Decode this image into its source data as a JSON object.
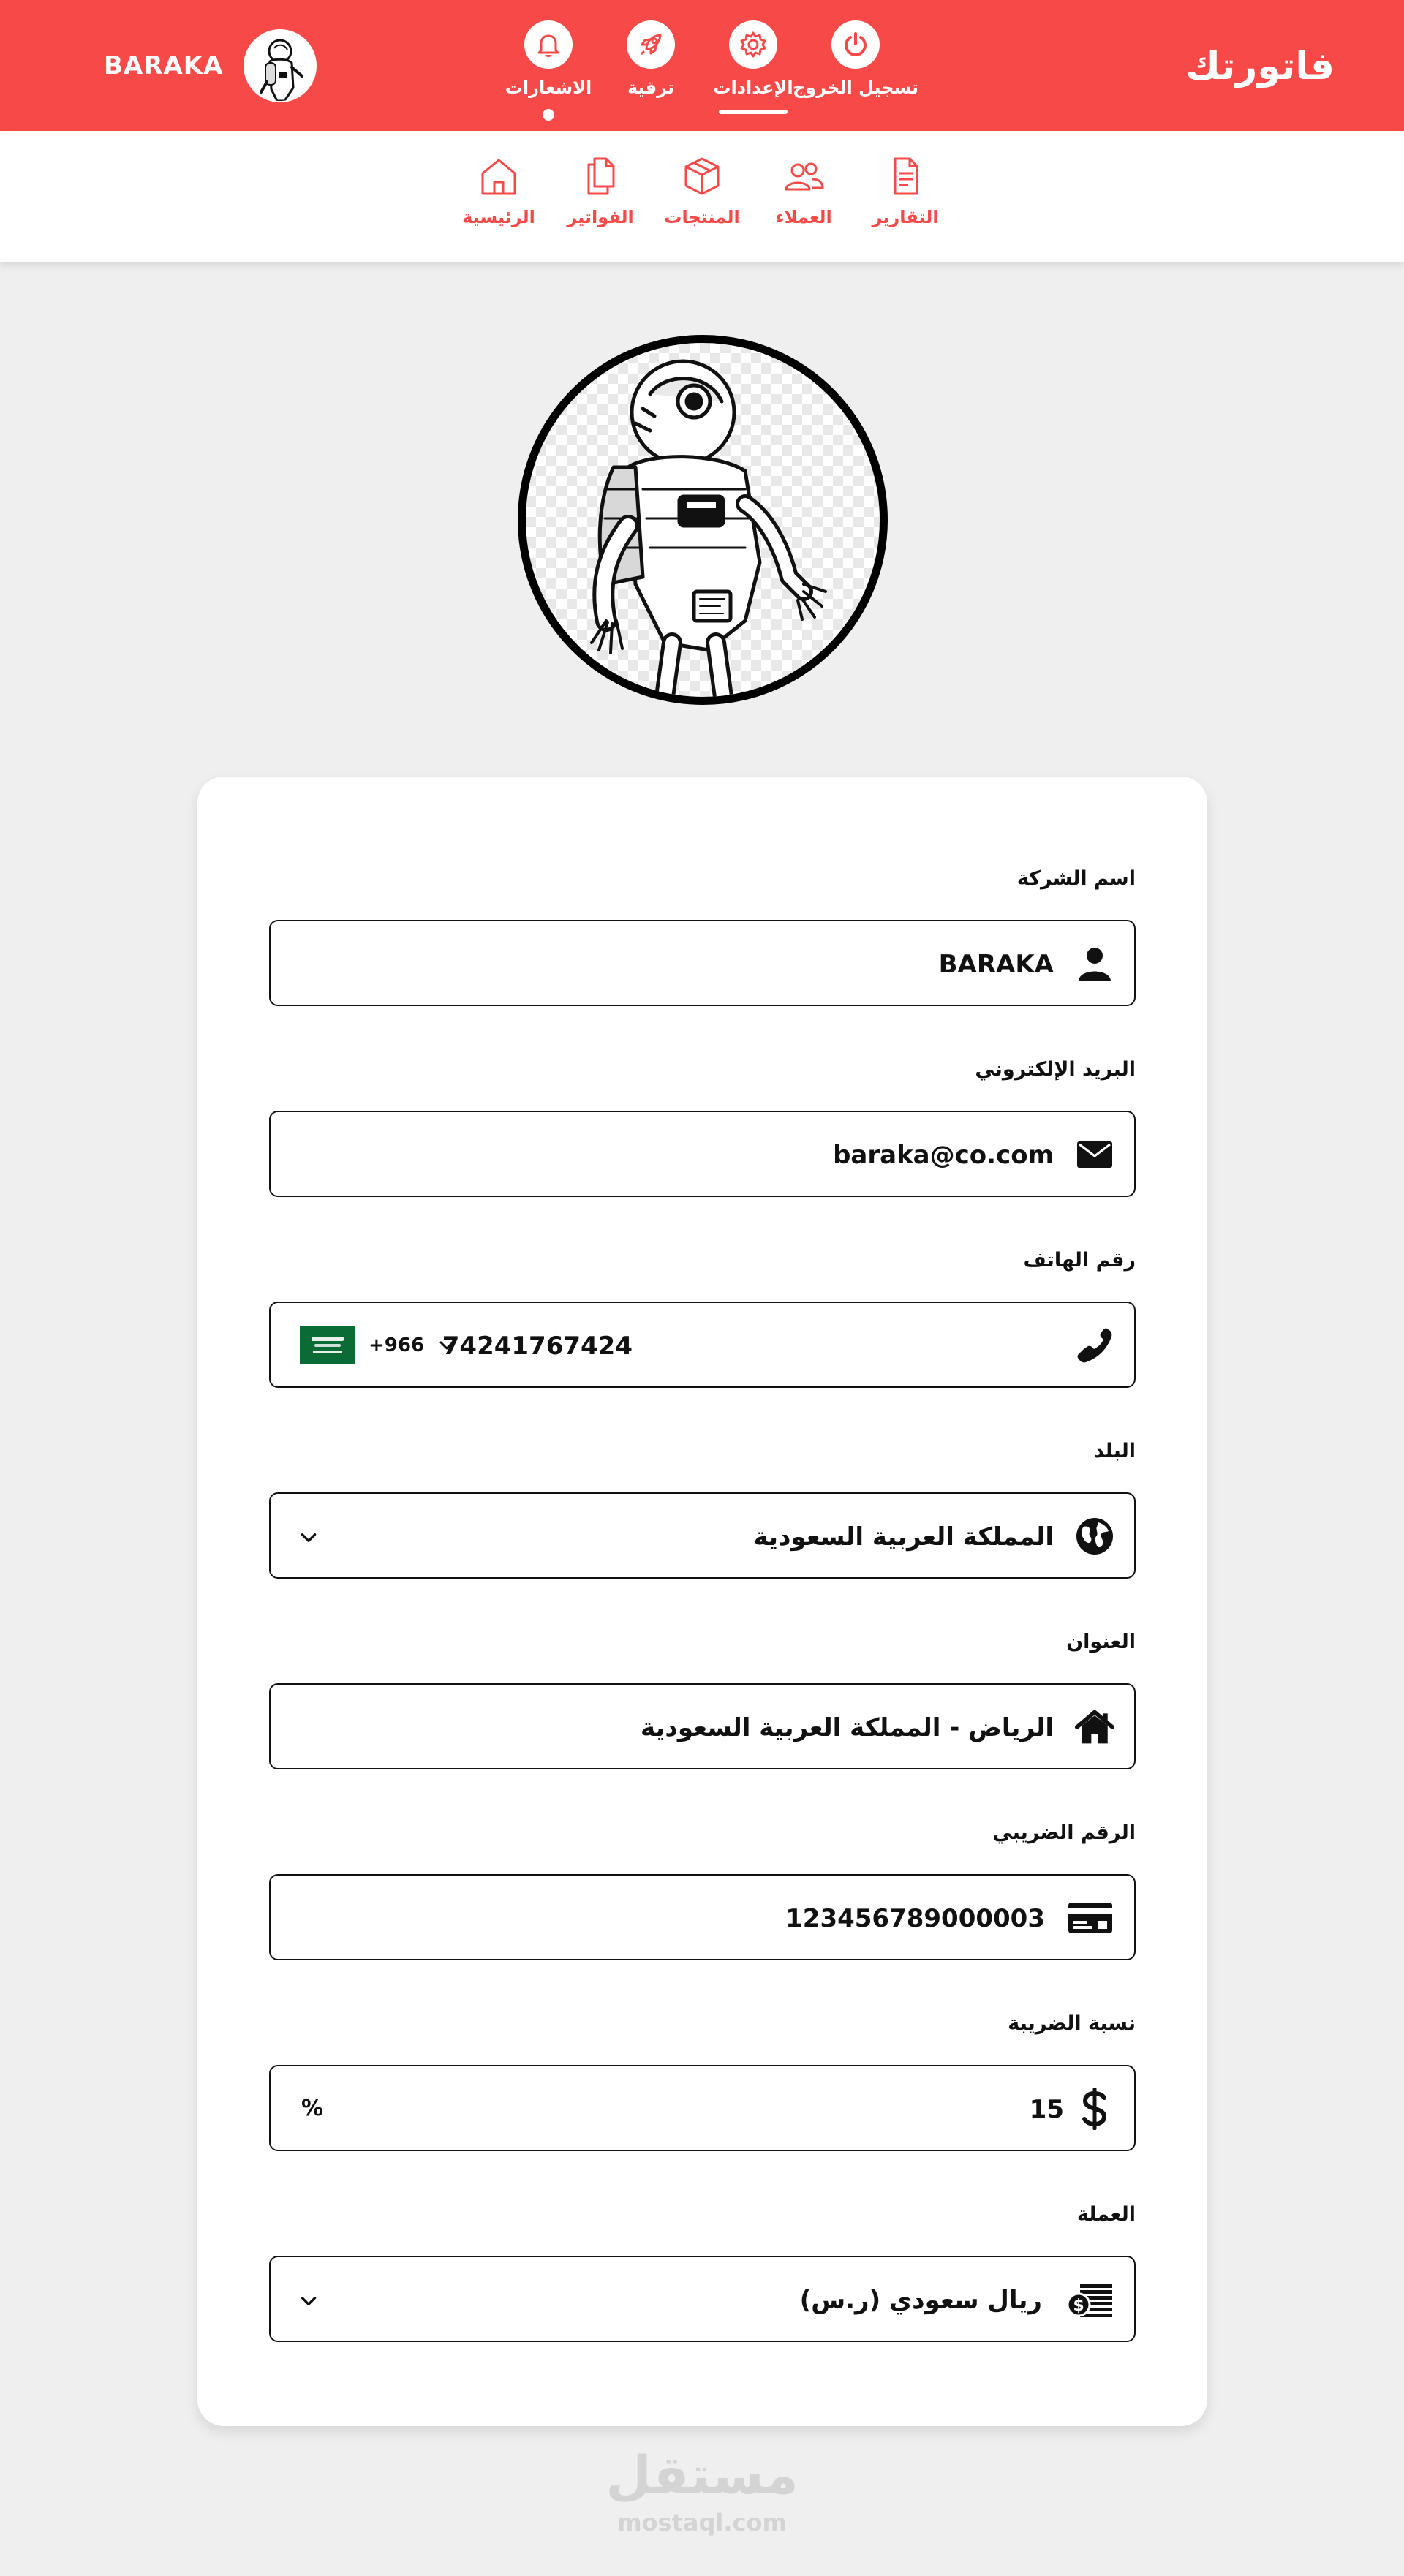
{
  "header": {
    "brand": "فاتورتك",
    "user_name": "BARAKA",
    "actions": [
      {
        "label": "الاشعارات",
        "icon": "bell-icon",
        "indicator": "dot"
      },
      {
        "label": "ترقية",
        "icon": "rocket-icon",
        "indicator": ""
      },
      {
        "label": "الإعدادات",
        "icon": "gear-icon",
        "indicator": "underline",
        "active": true
      },
      {
        "label": "تسجيل الخروج",
        "icon": "power-icon",
        "indicator": ""
      }
    ]
  },
  "subnav": {
    "items": [
      {
        "label": "الرئيسية",
        "icon": "home-icon"
      },
      {
        "label": "الفواتير",
        "icon": "documents-icon"
      },
      {
        "label": "المنتجات",
        "icon": "box-icon"
      },
      {
        "label": "العملاء",
        "icon": "users-icon"
      },
      {
        "label": "التقارير",
        "icon": "report-icon"
      }
    ]
  },
  "form": {
    "company_name": {
      "label": "اسم الشركة",
      "value": "BARAKA",
      "icon": "person-icon"
    },
    "email": {
      "label": "البريد الإلكتروني",
      "value": "baraka@co.com",
      "icon": "envelope-icon"
    },
    "phone": {
      "label": "رقم الهاتف",
      "value": "74241767424",
      "country_code": "+966",
      "icon": "phone-icon",
      "flag": "saudi-flag-icon"
    },
    "country": {
      "label": "البلد",
      "value": "المملكة العربية السعودية",
      "icon": "globe-icon"
    },
    "address": {
      "label": "العنوان",
      "value": "الرياض - المملكة العربية السعودية",
      "icon": "house-icon"
    },
    "tax_number": {
      "label": "الرقم الضريبي",
      "value": "123456789000003",
      "icon": "card-icon"
    },
    "tax_rate": {
      "label": "نسبة الضريبة",
      "value": "15",
      "suffix": "%",
      "icon": "dollar-icon"
    },
    "currency": {
      "label": "العملة",
      "value": "ريال سعودي (ر.س)",
      "icon": "money-stack-icon"
    }
  },
  "watermark": {
    "arabic": "مستقل",
    "latin": "mostaql.com"
  },
  "colors": {
    "accent": "#f74a48",
    "background": "#efefef",
    "card": "#ffffff",
    "flag_green": "#0a6b37"
  }
}
